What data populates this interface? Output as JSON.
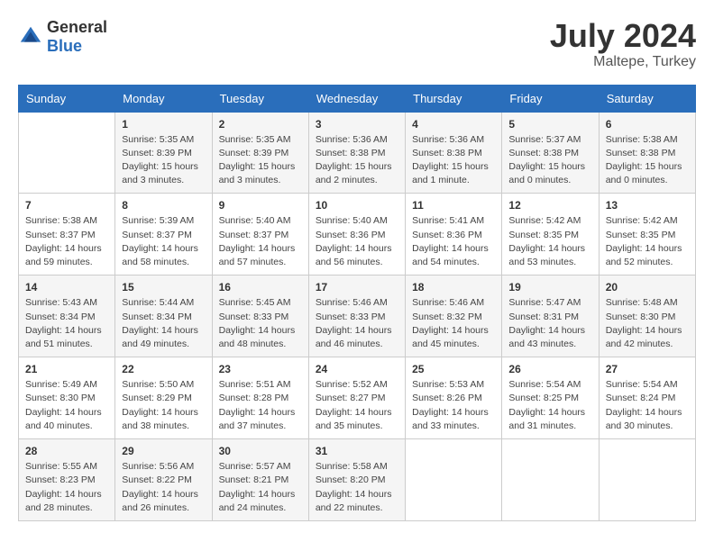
{
  "header": {
    "logo_general": "General",
    "logo_blue": "Blue",
    "month_year": "July 2024",
    "location": "Maltepe, Turkey"
  },
  "weekdays": [
    "Sunday",
    "Monday",
    "Tuesday",
    "Wednesday",
    "Thursday",
    "Friday",
    "Saturday"
  ],
  "weeks": [
    [
      {
        "day": "",
        "sunrise": "",
        "sunset": "",
        "daylight": ""
      },
      {
        "day": "1",
        "sunrise": "Sunrise: 5:35 AM",
        "sunset": "Sunset: 8:39 PM",
        "daylight": "Daylight: 15 hours and 3 minutes."
      },
      {
        "day": "2",
        "sunrise": "Sunrise: 5:35 AM",
        "sunset": "Sunset: 8:39 PM",
        "daylight": "Daylight: 15 hours and 3 minutes."
      },
      {
        "day": "3",
        "sunrise": "Sunrise: 5:36 AM",
        "sunset": "Sunset: 8:38 PM",
        "daylight": "Daylight: 15 hours and 2 minutes."
      },
      {
        "day": "4",
        "sunrise": "Sunrise: 5:36 AM",
        "sunset": "Sunset: 8:38 PM",
        "daylight": "Daylight: 15 hours and 1 minute."
      },
      {
        "day": "5",
        "sunrise": "Sunrise: 5:37 AM",
        "sunset": "Sunset: 8:38 PM",
        "daylight": "Daylight: 15 hours and 0 minutes."
      },
      {
        "day": "6",
        "sunrise": "Sunrise: 5:38 AM",
        "sunset": "Sunset: 8:38 PM",
        "daylight": "Daylight: 15 hours and 0 minutes."
      }
    ],
    [
      {
        "day": "7",
        "sunrise": "Sunrise: 5:38 AM",
        "sunset": "Sunset: 8:37 PM",
        "daylight": "Daylight: 14 hours and 59 minutes."
      },
      {
        "day": "8",
        "sunrise": "Sunrise: 5:39 AM",
        "sunset": "Sunset: 8:37 PM",
        "daylight": "Daylight: 14 hours and 58 minutes."
      },
      {
        "day": "9",
        "sunrise": "Sunrise: 5:40 AM",
        "sunset": "Sunset: 8:37 PM",
        "daylight": "Daylight: 14 hours and 57 minutes."
      },
      {
        "day": "10",
        "sunrise": "Sunrise: 5:40 AM",
        "sunset": "Sunset: 8:36 PM",
        "daylight": "Daylight: 14 hours and 56 minutes."
      },
      {
        "day": "11",
        "sunrise": "Sunrise: 5:41 AM",
        "sunset": "Sunset: 8:36 PM",
        "daylight": "Daylight: 14 hours and 54 minutes."
      },
      {
        "day": "12",
        "sunrise": "Sunrise: 5:42 AM",
        "sunset": "Sunset: 8:35 PM",
        "daylight": "Daylight: 14 hours and 53 minutes."
      },
      {
        "day": "13",
        "sunrise": "Sunrise: 5:42 AM",
        "sunset": "Sunset: 8:35 PM",
        "daylight": "Daylight: 14 hours and 52 minutes."
      }
    ],
    [
      {
        "day": "14",
        "sunrise": "Sunrise: 5:43 AM",
        "sunset": "Sunset: 8:34 PM",
        "daylight": "Daylight: 14 hours and 51 minutes."
      },
      {
        "day": "15",
        "sunrise": "Sunrise: 5:44 AM",
        "sunset": "Sunset: 8:34 PM",
        "daylight": "Daylight: 14 hours and 49 minutes."
      },
      {
        "day": "16",
        "sunrise": "Sunrise: 5:45 AM",
        "sunset": "Sunset: 8:33 PM",
        "daylight": "Daylight: 14 hours and 48 minutes."
      },
      {
        "day": "17",
        "sunrise": "Sunrise: 5:46 AM",
        "sunset": "Sunset: 8:33 PM",
        "daylight": "Daylight: 14 hours and 46 minutes."
      },
      {
        "day": "18",
        "sunrise": "Sunrise: 5:46 AM",
        "sunset": "Sunset: 8:32 PM",
        "daylight": "Daylight: 14 hours and 45 minutes."
      },
      {
        "day": "19",
        "sunrise": "Sunrise: 5:47 AM",
        "sunset": "Sunset: 8:31 PM",
        "daylight": "Daylight: 14 hours and 43 minutes."
      },
      {
        "day": "20",
        "sunrise": "Sunrise: 5:48 AM",
        "sunset": "Sunset: 8:30 PM",
        "daylight": "Daylight: 14 hours and 42 minutes."
      }
    ],
    [
      {
        "day": "21",
        "sunrise": "Sunrise: 5:49 AM",
        "sunset": "Sunset: 8:30 PM",
        "daylight": "Daylight: 14 hours and 40 minutes."
      },
      {
        "day": "22",
        "sunrise": "Sunrise: 5:50 AM",
        "sunset": "Sunset: 8:29 PM",
        "daylight": "Daylight: 14 hours and 38 minutes."
      },
      {
        "day": "23",
        "sunrise": "Sunrise: 5:51 AM",
        "sunset": "Sunset: 8:28 PM",
        "daylight": "Daylight: 14 hours and 37 minutes."
      },
      {
        "day": "24",
        "sunrise": "Sunrise: 5:52 AM",
        "sunset": "Sunset: 8:27 PM",
        "daylight": "Daylight: 14 hours and 35 minutes."
      },
      {
        "day": "25",
        "sunrise": "Sunrise: 5:53 AM",
        "sunset": "Sunset: 8:26 PM",
        "daylight": "Daylight: 14 hours and 33 minutes."
      },
      {
        "day": "26",
        "sunrise": "Sunrise: 5:54 AM",
        "sunset": "Sunset: 8:25 PM",
        "daylight": "Daylight: 14 hours and 31 minutes."
      },
      {
        "day": "27",
        "sunrise": "Sunrise: 5:54 AM",
        "sunset": "Sunset: 8:24 PM",
        "daylight": "Daylight: 14 hours and 30 minutes."
      }
    ],
    [
      {
        "day": "28",
        "sunrise": "Sunrise: 5:55 AM",
        "sunset": "Sunset: 8:23 PM",
        "daylight": "Daylight: 14 hours and 28 minutes."
      },
      {
        "day": "29",
        "sunrise": "Sunrise: 5:56 AM",
        "sunset": "Sunset: 8:22 PM",
        "daylight": "Daylight: 14 hours and 26 minutes."
      },
      {
        "day": "30",
        "sunrise": "Sunrise: 5:57 AM",
        "sunset": "Sunset: 8:21 PM",
        "daylight": "Daylight: 14 hours and 24 minutes."
      },
      {
        "day": "31",
        "sunrise": "Sunrise: 5:58 AM",
        "sunset": "Sunset: 8:20 PM",
        "daylight": "Daylight: 14 hours and 22 minutes."
      },
      {
        "day": "",
        "sunrise": "",
        "sunset": "",
        "daylight": ""
      },
      {
        "day": "",
        "sunrise": "",
        "sunset": "",
        "daylight": ""
      },
      {
        "day": "",
        "sunrise": "",
        "sunset": "",
        "daylight": ""
      }
    ]
  ]
}
